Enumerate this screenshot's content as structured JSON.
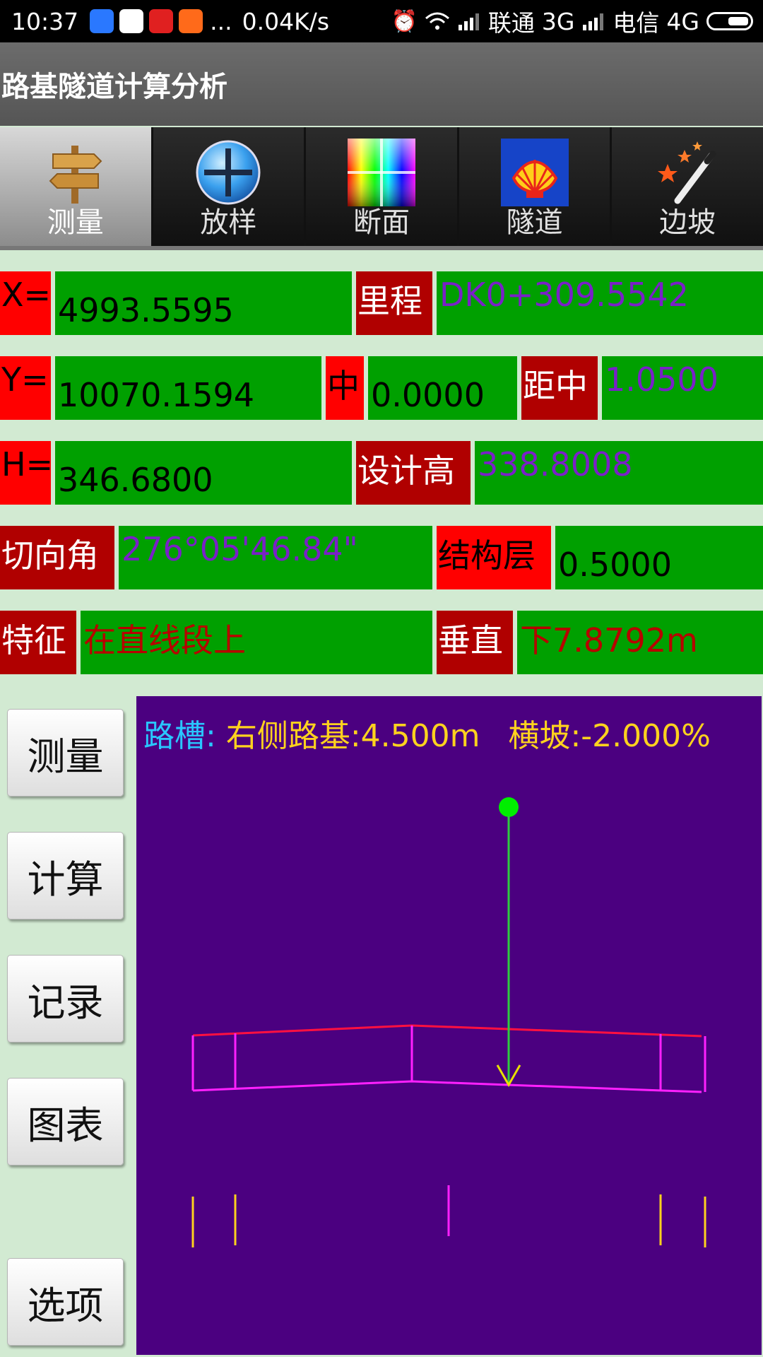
{
  "status_bar": {
    "time": "10:37",
    "speed": "0.04K/s",
    "carrier1": "联通",
    "net1": "3G",
    "carrier2": "电信",
    "net2": "4G",
    "more": "..."
  },
  "app": {
    "title": "路基隧道计算分析"
  },
  "tabs": [
    {
      "label": "测量",
      "icon": "signpost-icon",
      "active": true
    },
    {
      "label": "放样",
      "icon": "plus-globe-icon",
      "active": false
    },
    {
      "label": "断面",
      "icon": "color-grid-icon",
      "active": false
    },
    {
      "label": "隧道",
      "icon": "shell-icon",
      "active": false
    },
    {
      "label": "边坡",
      "icon": "magic-wand-icon",
      "active": false
    }
  ],
  "fields": {
    "x_label": "X=",
    "x_value": "4993.5595",
    "mileage_label": "里程",
    "mileage_value": "DK0+309.5542",
    "y_label": "Y=",
    "y_value": "10070.1594",
    "center_label": "中",
    "center_value": "0.0000",
    "dist_label": "距中",
    "dist_value": "1.0500",
    "h_label": "H=",
    "h_value": "346.6800",
    "design_label": "设计高",
    "design_value": "338.8008",
    "tangent_label": "切向角",
    "tangent_value": "276°05'46.84\"",
    "struct_label": "结构层",
    "struct_value": "0.5000",
    "feature_label": "特征",
    "feature_value": "在直线段上",
    "vertical_label": "垂直",
    "vertical_value": "下7.8792m"
  },
  "buttons": {
    "measure": "测量",
    "calculate": "计算",
    "record": "记录",
    "chart": "图表",
    "options": "选项"
  },
  "cross_section": {
    "label_a": "路槽:",
    "label_b": "右侧路基:4.500m",
    "label_c": "横坡:-2.000%"
  },
  "colors": {
    "panel_bg": "#4b0080",
    "red_cell": "#ff0000",
    "dark_red_cell": "#b00000",
    "green_cell": "#00a000",
    "purple_text": "#7a20c8",
    "section_top_line": "#ff1040",
    "section_outline": "#ff20ff",
    "marker_green": "#00ee00",
    "arrow_yellow": "#e8e000"
  }
}
